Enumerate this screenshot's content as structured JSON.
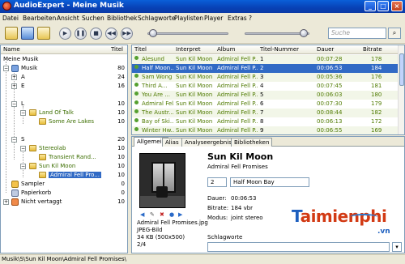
{
  "window": {
    "title": "AudioExpert - Meine Musik"
  },
  "menu": [
    "Datei",
    "Bearbeiten",
    "Ansicht",
    "Suchen",
    "Bibliothek",
    "Schlagworte",
    "Playlisten",
    "Player",
    "Extras",
    "?"
  ],
  "search": {
    "placeholder": "Suche"
  },
  "tree": {
    "headers": {
      "name": "Name",
      "count": "Titel"
    },
    "items": [
      {
        "label": "Meine Musik",
        "count": ""
      },
      {
        "label": "Musik",
        "count": "80"
      },
      {
        "label": "A",
        "count": "24"
      },
      {
        "label": "E",
        "count": "16"
      },
      {
        "label": "L",
        "count": "10"
      },
      {
        "label": "Land Of Talk",
        "count": "10"
      },
      {
        "label": "Some Are Lakes",
        "count": "10"
      },
      {
        "label": "S",
        "count": "20"
      },
      {
        "label": "Stereolab",
        "count": "10"
      },
      {
        "label": "Transient Rand...",
        "count": "10"
      },
      {
        "label": "Sun Kil Moon",
        "count": "10"
      },
      {
        "label": "Admiral Fell Pro...",
        "count": "10"
      },
      {
        "label": "Sampler",
        "count": "0"
      },
      {
        "label": "Papierkorb",
        "count": "0"
      },
      {
        "label": "Nicht vertaggt",
        "count": "10"
      }
    ]
  },
  "tracks": {
    "headers": {
      "title": "Titel",
      "artist": "Interpret",
      "album": "Album",
      "number": "Titel-Nummer",
      "duration": "Dauer",
      "bitrate": "Bitrate"
    },
    "rows": [
      {
        "title": "Alesund",
        "artist": "Sun Kil Moon",
        "album": "Admiral Fell P...",
        "number": "1",
        "duration": "00:07:28",
        "bitrate": "178"
      },
      {
        "title": "Half Moon...",
        "artist": "Sun Kil Moon",
        "album": "Admiral Fell P...",
        "number": "2",
        "duration": "00:06:53",
        "bitrate": "184"
      },
      {
        "title": "Sam Wong ...",
        "artist": "Sun Kil Moon",
        "album": "Admiral Fell P...",
        "number": "3",
        "duration": "00:05:36",
        "bitrate": "176"
      },
      {
        "title": "Third A...",
        "artist": "Sun Kil Moon",
        "album": "Admiral Fell P...",
        "number": "4",
        "duration": "00:07:45",
        "bitrate": "181"
      },
      {
        "title": "You Are ...",
        "artist": "Sun Kil Moon",
        "album": "Admiral Fell P...",
        "number": "5",
        "duration": "00:06:03",
        "bitrate": "180"
      },
      {
        "title": "Admiral Fel...",
        "artist": "Sun Kil Moon",
        "album": "Admiral Fell P...",
        "number": "6",
        "duration": "00:07:30",
        "bitrate": "179"
      },
      {
        "title": "The Austr...",
        "artist": "Sun Kil Moon",
        "album": "Admiral Fell P...",
        "number": "7",
        "duration": "00:08:44",
        "bitrate": "182"
      },
      {
        "title": "Bay of Ski...",
        "artist": "Sun Kil Moon",
        "album": "Admiral Fell P...",
        "number": "8",
        "duration": "00:06:13",
        "bitrate": "172"
      },
      {
        "title": "Winter Hw...",
        "artist": "Sun Kil Moon",
        "album": "Admiral Fell P...",
        "number": "9",
        "duration": "00:06:55",
        "bitrate": "169"
      }
    ]
  },
  "detail": {
    "tabs": [
      "Allgemein",
      "Alias",
      "Analyseergebnis",
      "Bibliotheken"
    ],
    "artist": "Sun Kil Moon",
    "album": "Admiral Fell Promises",
    "track_number": "2",
    "track_title": "Half Moon Bay",
    "labels": {
      "duration": "Dauer:",
      "bitrate": "Bitrate:",
      "mode": "Modus:",
      "tags": "Schlagworte"
    },
    "duration": "00:06:53",
    "bitrate": "184 vbr",
    "mode": "joint stereo",
    "cover_file": "Admiral Fell Promises.jpg",
    "cover_type": "JPEG-Bild",
    "cover_size": "34 KB (500x500)",
    "cover_page": "2/4"
  },
  "status": {
    "path": "Musik\\S\\Sun Kil Moon\\Admiral Fell Promises\\"
  },
  "watermark": {
    "brand_a": "aimienphi",
    "brand_t": "T",
    "suffix": ".vn"
  }
}
